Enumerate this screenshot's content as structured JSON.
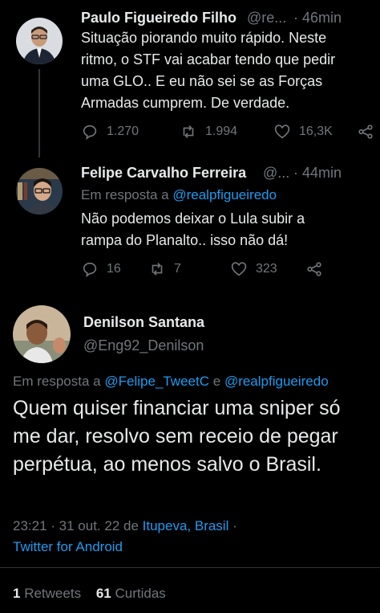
{
  "tweet1": {
    "name": "Paulo Figueiredo Filho",
    "handle": "@re...",
    "time": "· 46min",
    "text": "Situação piorando muito rápido. Neste ritmo, o STF vai acabar tendo que pedir uma GLO.. E eu não sei se as Forças Armadas cumprem. De verdade.",
    "replies": "1.270",
    "retweets": "1.994",
    "likes": "16,3K"
  },
  "tweet2": {
    "name": "Felipe Carvalho Ferreira",
    "handle": "@...",
    "time": "· 44min",
    "reply_prefix": "Em resposta a",
    "reply_to": "@realpfigueiredo",
    "text": "Não podemos deixar o Lula subir a rampa do Planalto..  isso não dá!",
    "replies": "16",
    "retweets": "7",
    "likes": "323"
  },
  "main": {
    "name": "Denilson Santana",
    "handle": "@Eng92_Denilson",
    "reply_prefix": "Em resposta a",
    "reply_to_1": "@Felipe_TweetC",
    "reply_and": "e",
    "reply_to_2": "@realpfigueiredo",
    "text": "Quem quiser financiar uma sniper só me dar, resolvo sem receio de pegar perpétua, ao menos salvo o Brasil.",
    "timestamp": "23:21 · 31 out. 22 de",
    "location": "Itupeva, Brasil",
    "sep": "·",
    "source": "Twitter for Android",
    "retweets_count": "1",
    "retweets_label": "Retweets",
    "likes_count": "61",
    "likes_label": "Curtidas"
  },
  "icons": {
    "reply": "reply-icon",
    "retweet": "retweet-icon",
    "like": "heart-icon",
    "share": "share-icon"
  },
  "colors": {
    "background": "#000000",
    "text": "#e7e9ea",
    "muted": "#71767b",
    "link": "#1d9bf0"
  }
}
